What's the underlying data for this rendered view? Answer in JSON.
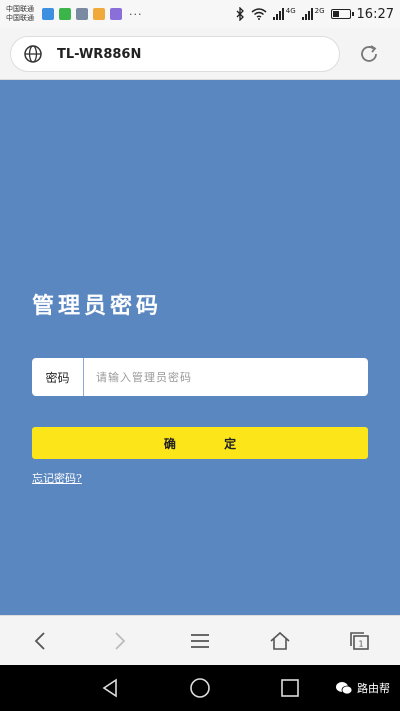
{
  "status_bar": {
    "carrier_line1": "中国联通",
    "carrier_line2": "中国联通",
    "network_1": "4G",
    "network_2": "2G",
    "time": "16:27",
    "notification_icons": [
      {
        "name": "cloud-app-icon",
        "color": "#3d8fe0"
      },
      {
        "name": "wechat-icon",
        "color": "#3bb54a"
      },
      {
        "name": "gallery-icon",
        "color": "#7a8aa0"
      },
      {
        "name": "photo-app-icon",
        "color": "#f2a93b"
      },
      {
        "name": "chat-app-icon",
        "color": "#8a6fd8"
      }
    ]
  },
  "browser": {
    "url": "TL-WR886N"
  },
  "login": {
    "title": "管理员密码",
    "password_label": "密码",
    "password_placeholder": "请输入管理员密码",
    "password_value": "",
    "confirm_button": "确 定",
    "forgot_link": "忘记密码?"
  },
  "watermark": {
    "text": "路由帮"
  },
  "colors": {
    "background": "#5b87c0",
    "button": "#fce61a"
  }
}
